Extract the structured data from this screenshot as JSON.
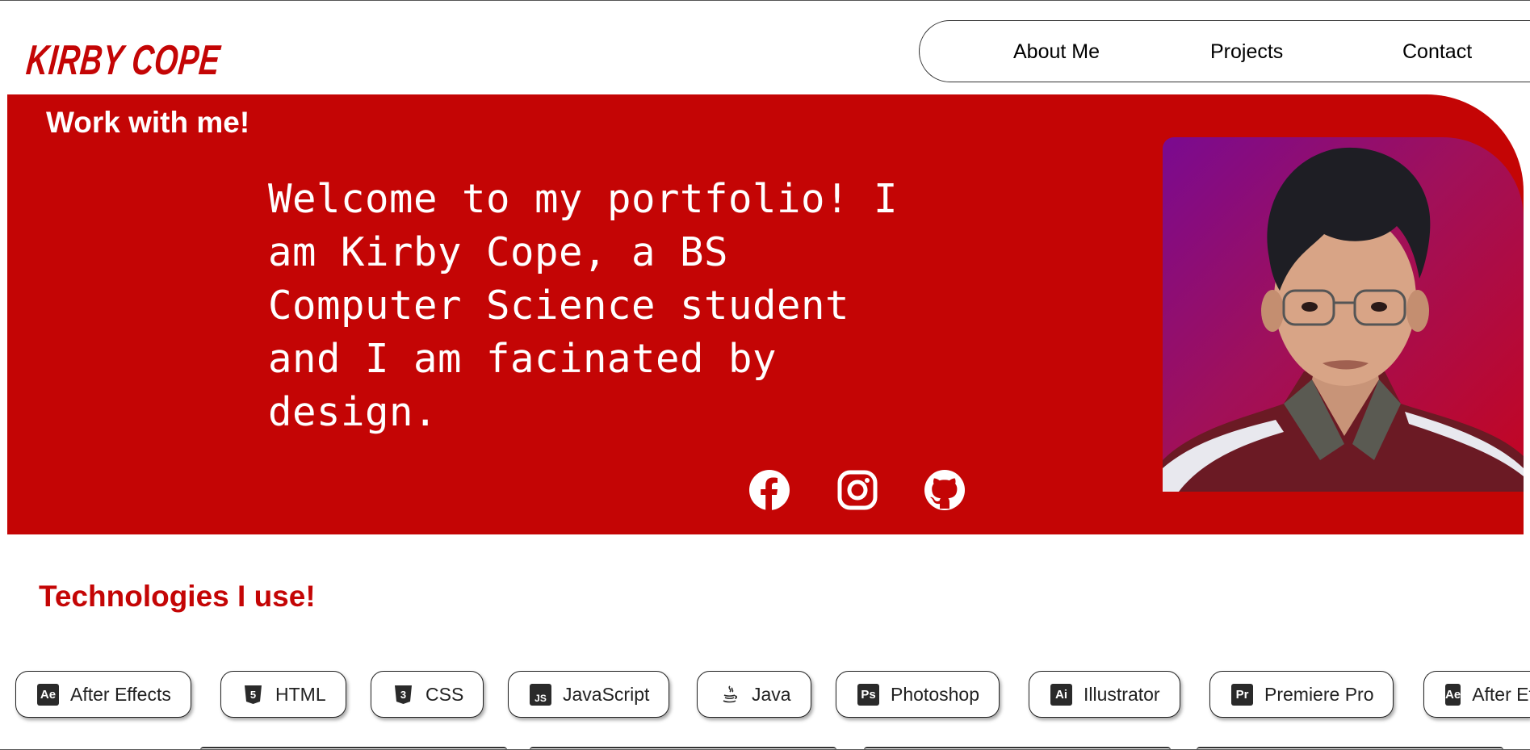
{
  "header": {
    "logo_text": "KIRBY COPE",
    "nav": [
      "About Me",
      "Projects",
      "Contact"
    ]
  },
  "hero": {
    "cta": "Work with me!",
    "welcome": "Welcome to my portfolio! I am Kirby Cope, a BS Computer Science student and I am facinated by design.",
    "social_icons": [
      "facebook-icon",
      "instagram-icon",
      "github-icon"
    ],
    "background_color": "#c40505"
  },
  "technologies": {
    "title": "Technologies I use!",
    "chips": [
      {
        "label": "After Effects",
        "icon": "after-effects-icon",
        "badge": "Ae"
      },
      {
        "label": "HTML",
        "icon": "html5-icon",
        "badge": "5"
      },
      {
        "label": "CSS",
        "icon": "css3-icon",
        "badge": "3"
      },
      {
        "label": "JavaScript",
        "icon": "javascript-icon",
        "badge": "JS"
      },
      {
        "label": "Java",
        "icon": "java-icon",
        "badge": ""
      },
      {
        "label": "Photoshop",
        "icon": "photoshop-icon",
        "badge": "Ps"
      },
      {
        "label": "Illustrator",
        "icon": "illustrator-icon",
        "badge": "Ai"
      },
      {
        "label": "Premiere Pro",
        "icon": "premiere-pro-icon",
        "badge": "Pr"
      },
      {
        "label": "After Effects",
        "icon": "after-effects-icon",
        "badge": "Ae"
      }
    ]
  }
}
